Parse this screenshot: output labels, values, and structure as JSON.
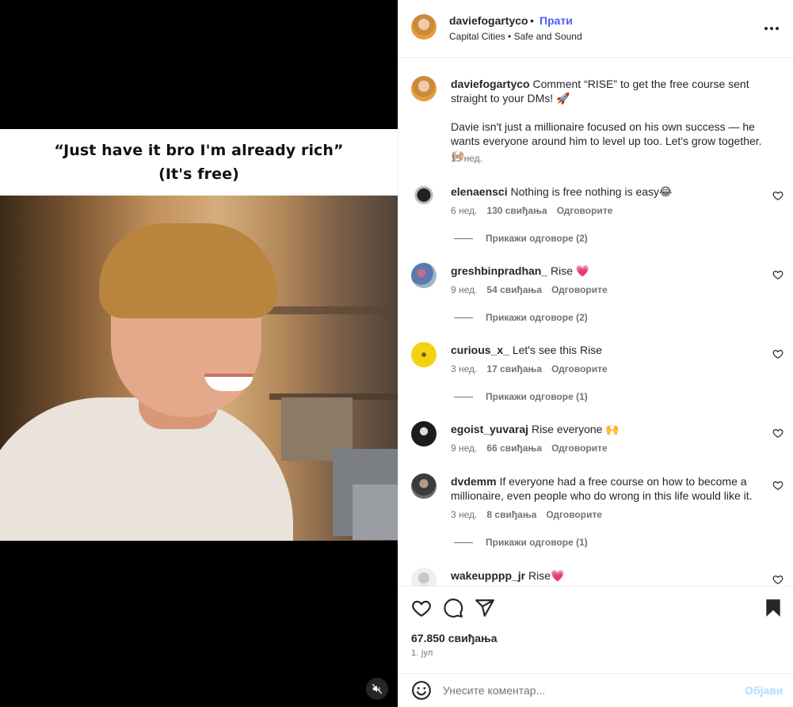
{
  "media": {
    "overlay_line1": "“Just have it bro I'm already rich”",
    "overlay_line2": "(It's free)"
  },
  "header": {
    "username": "daviefogartyco",
    "separator": "•",
    "follow_label": "Прати",
    "audio": "Capital Cities • Safe and Sound"
  },
  "caption": {
    "username": "daviefogartyco",
    "text1": "Comment “RISE” to get the free course sent straight to your DMs! 🚀",
    "text2": "Davie isn't just a millionaire focused on his own success — he wants everyone around him to level up too. Let's grow together. 🙌🏼",
    "time": "15 нед."
  },
  "comments": [
    {
      "username": "elenaensci",
      "text": "Nothing is free nothing is easy😂",
      "time": "6 нед.",
      "likes": "130 свиђања",
      "reply": "Одговорите",
      "replies": "Прикажи одговоре (2)"
    },
    {
      "username": "greshbinpradhan_",
      "text": "Rise 💗",
      "time": "9 нед.",
      "likes": "54 свиђања",
      "reply": "Одговорите",
      "replies": "Прикажи одговоре (2)"
    },
    {
      "username": "curious_x_",
      "text": "Let's see this Rise",
      "time": "3 нед.",
      "likes": "17 свиђања",
      "reply": "Одговорите",
      "replies": "Прикажи одговоре (1)"
    },
    {
      "username": "egoist_yuvaraj",
      "text": "Rise everyone 🙌",
      "time": "9 нед.",
      "likes": "66 свиђања",
      "reply": "Одговорите",
      "replies": ""
    },
    {
      "username": "dvdemm",
      "text": "If everyone had a free course on how to become a millionaire, even people who do wrong in this life would like it.",
      "time": "3 нед.",
      "likes": "8 свиђања",
      "reply": "Одговорите",
      "replies": "Прикажи одговоре (1)"
    },
    {
      "username": "wakeupppp_jr",
      "text": "Rise💗",
      "time": "",
      "likes": "",
      "reply": "",
      "replies": ""
    }
  ],
  "footer": {
    "likes_total": "67.850 свиђања",
    "date": "1. јул",
    "comment_placeholder": "Унесите коментар...",
    "post_label": "Објави"
  },
  "icons": {
    "like": "heart-icon",
    "comment": "comment-icon",
    "share": "share-icon",
    "save": "bookmark-icon",
    "more": "more-options-icon",
    "emoji": "emoji-icon",
    "mute": "muted-speaker-icon"
  },
  "colors": {
    "link_blue": "#4a5df9",
    "post_disabled": "#b3dbff",
    "muted_text": "#737373",
    "border": "#efefef"
  }
}
